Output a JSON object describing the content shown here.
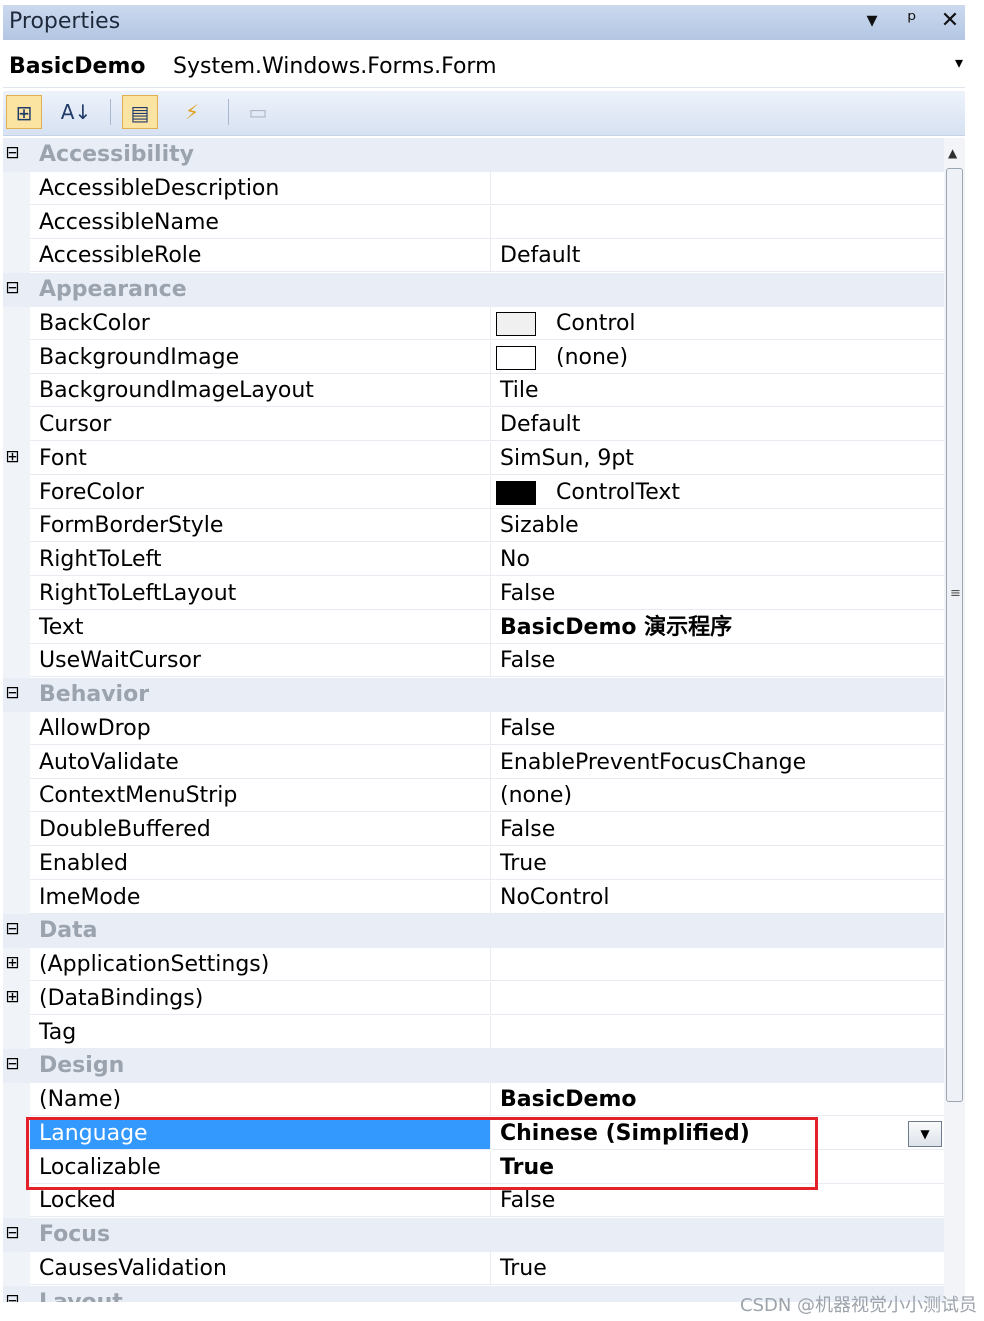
{
  "window": {
    "title": "Properties",
    "buttons": [
      "▾",
      "ᵖ",
      "✕"
    ]
  },
  "object_selector": {
    "name": "BasicDemo",
    "type": "System.Windows.Forms.Form"
  },
  "toolbar": {
    "tools": [
      {
        "icon": "categorized-icon",
        "glyph": "⊞",
        "active": true
      },
      {
        "icon": "alphabetical-sort-icon",
        "glyph": "↓",
        "active": false
      },
      {
        "icon": "properties-icon",
        "glyph": "▤",
        "active": true
      },
      {
        "icon": "events-lightning-icon",
        "glyph": "⚡",
        "active": false
      },
      {
        "icon": "property-pages-icon",
        "glyph": "▭",
        "active": false
      }
    ]
  },
  "grid": {
    "rows": [
      {
        "kind": "category",
        "name": "Accessibility",
        "expander": "⊟"
      },
      {
        "kind": "prop",
        "name": "AccessibleDescription",
        "value": ""
      },
      {
        "kind": "prop",
        "name": "AccessibleName",
        "value": ""
      },
      {
        "kind": "prop",
        "name": "AccessibleRole",
        "value": "Default"
      },
      {
        "kind": "category",
        "name": "Appearance",
        "expander": "⊟"
      },
      {
        "kind": "prop",
        "name": "BackColor",
        "value": "Control",
        "swatch": "#f0f0f0"
      },
      {
        "kind": "prop",
        "name": "BackgroundImage",
        "value": "(none)",
        "swatch": "#ffffff"
      },
      {
        "kind": "prop",
        "name": "BackgroundImageLayout",
        "value": "Tile"
      },
      {
        "kind": "prop",
        "name": "Cursor",
        "value": "Default"
      },
      {
        "kind": "prop",
        "name": "Font",
        "value": "SimSun, 9pt",
        "expander": "⊞"
      },
      {
        "kind": "prop",
        "name": "ForeColor",
        "value": "ControlText",
        "swatch": "#000000"
      },
      {
        "kind": "prop",
        "name": "FormBorderStyle",
        "value": "Sizable"
      },
      {
        "kind": "prop",
        "name": "RightToLeft",
        "value": "No"
      },
      {
        "kind": "prop",
        "name": "RightToLeftLayout",
        "value": "False"
      },
      {
        "kind": "prop",
        "name": "Text",
        "value": "BasicDemo 演示程序",
        "bold": true
      },
      {
        "kind": "prop",
        "name": "UseWaitCursor",
        "value": "False"
      },
      {
        "kind": "category",
        "name": "Behavior",
        "expander": "⊟"
      },
      {
        "kind": "prop",
        "name": "AllowDrop",
        "value": "False"
      },
      {
        "kind": "prop",
        "name": "AutoValidate",
        "value": "EnablePreventFocusChange"
      },
      {
        "kind": "prop",
        "name": "ContextMenuStrip",
        "value": "(none)"
      },
      {
        "kind": "prop",
        "name": "DoubleBuffered",
        "value": "False"
      },
      {
        "kind": "prop",
        "name": "Enabled",
        "value": "True"
      },
      {
        "kind": "prop",
        "name": "ImeMode",
        "value": "NoControl"
      },
      {
        "kind": "category",
        "name": "Data",
        "expander": "⊟"
      },
      {
        "kind": "prop",
        "name": "(ApplicationSettings)",
        "value": "",
        "expander": "⊞"
      },
      {
        "kind": "prop",
        "name": "(DataBindings)",
        "value": "",
        "expander": "⊞"
      },
      {
        "kind": "prop",
        "name": "Tag",
        "value": ""
      },
      {
        "kind": "category",
        "name": "Design",
        "expander": "⊟"
      },
      {
        "kind": "prop",
        "name": "(Name)",
        "value": "BasicDemo",
        "bold": true
      },
      {
        "kind": "prop",
        "name": "Language",
        "value": "Chinese (Simplified)",
        "bold": true,
        "selected": true,
        "dropdown": true
      },
      {
        "kind": "prop",
        "name": "Localizable",
        "value": "True",
        "bold": true
      },
      {
        "kind": "prop",
        "name": "Locked",
        "value": "False"
      },
      {
        "kind": "category",
        "name": "Focus",
        "expander": "⊟"
      },
      {
        "kind": "prop",
        "name": "CausesValidation",
        "value": "True"
      },
      {
        "kind": "category",
        "name": "Layout",
        "expander": "⊟"
      }
    ]
  },
  "colors": {
    "selection": "#3399ff",
    "highlight_box": "#e3212b",
    "category_bg": "#e9eef6"
  },
  "watermark": "CSDN @机器视觉小小测试员"
}
